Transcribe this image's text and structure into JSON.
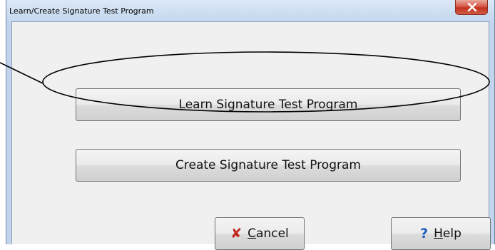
{
  "window": {
    "title": "Learn/Create Signature Test Program"
  },
  "buttons": {
    "learn_label": "Learn Signature Test Program",
    "create_label": "Create Signature Test Program",
    "cancel_mnemonic": "C",
    "cancel_rest": "ancel",
    "help_mnemonic": "H",
    "help_rest": "elp"
  },
  "icons": {
    "close": "close-icon",
    "cancel": "x-icon",
    "help": "question-mark-icon"
  },
  "colors": {
    "close_button": "#c2321f",
    "cancel_icon": "#c0281e",
    "help_icon": "#1f5fbf"
  }
}
